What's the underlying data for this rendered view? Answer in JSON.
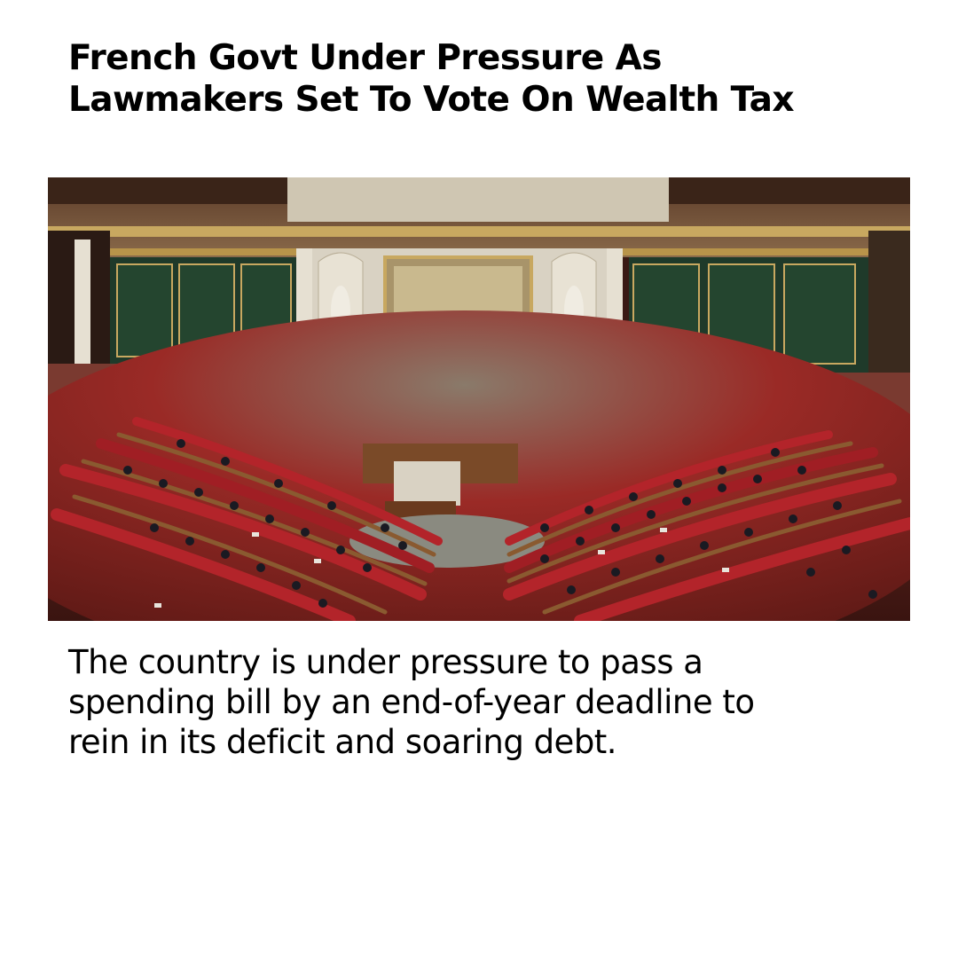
{
  "article": {
    "headline_line1": "French Govt Under Pressure As",
    "headline_line2": "Lawmakers Set To Vote On Wealth Tax",
    "caption_line1": "The country is under pressure to pass a",
    "caption_line2": "spending bill by an end-of-year deadline to",
    "caption_line3": "rein in its deficit and soaring debt."
  },
  "photo": {
    "subject": "French National Assembly chamber (hemicycle) with red seats and lawmakers",
    "colors": {
      "seats": "#b3242a",
      "wall_panels": "#1f3a2a",
      "marble": "#d9d2c3",
      "wood": "#7a4a28",
      "screens": "#2f5fd0"
    }
  }
}
